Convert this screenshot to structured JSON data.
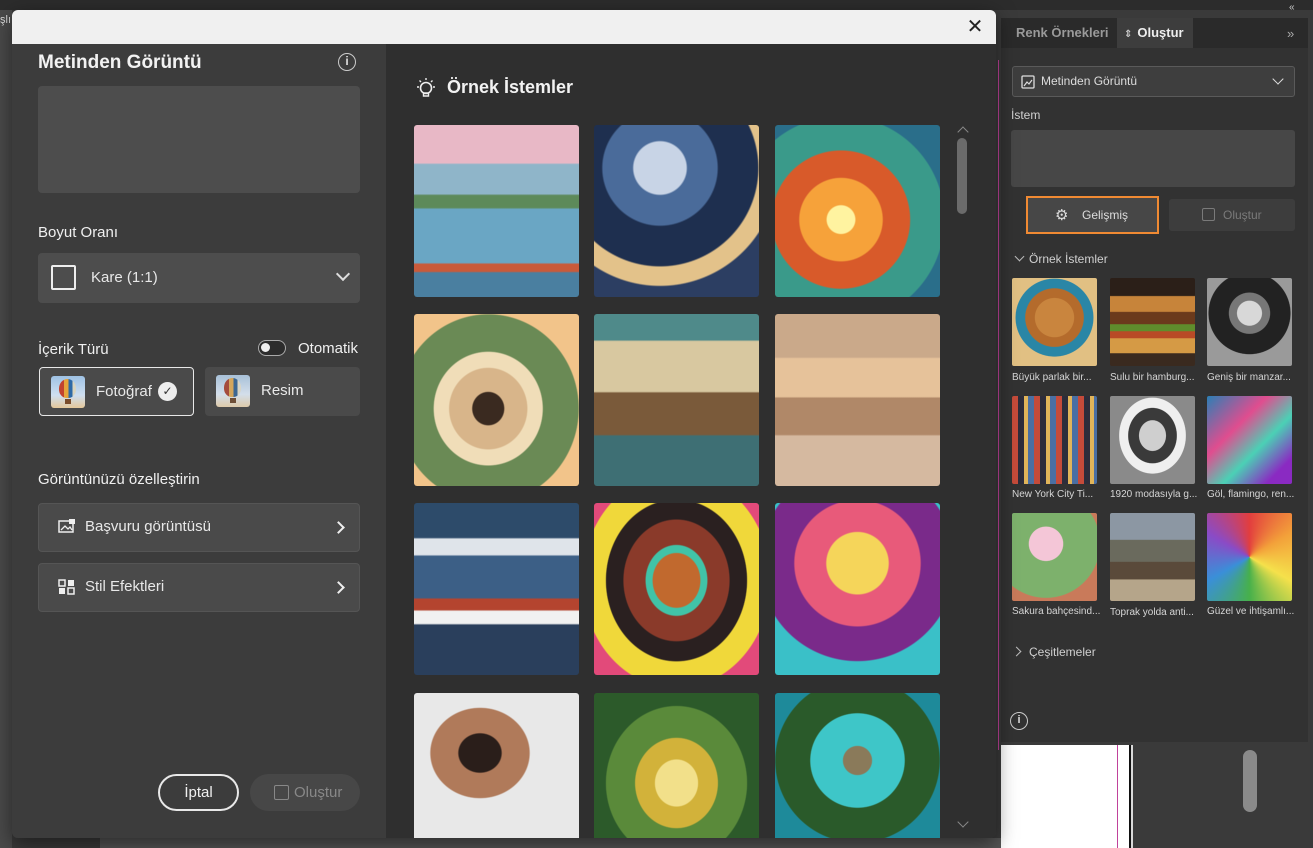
{
  "background": {
    "left_fragment": "şlı"
  },
  "dialog": {
    "close_symbol": "✕",
    "title": "Metinden Görüntü",
    "info_symbol": "i",
    "aspect_label": "Boyut Oranı",
    "aspect_value": "Kare (1:1)",
    "content_type_label": "İçerik Türü",
    "auto_label": "Otomatik",
    "content_types": [
      {
        "label": "Fotoğraf",
        "selected": true
      },
      {
        "label": "Resim",
        "selected": false
      }
    ],
    "customize_label": "Görüntünüzü özelleştirin",
    "reference_label": "Başvuru görüntüsü",
    "styles_label": "Stil Efektleri",
    "cancel_label": "İptal",
    "generate_label": "Oluştur",
    "examples_title": "Örnek İstemler"
  },
  "panel": {
    "tabs": [
      "Renk Örnekleri",
      "Oluştur"
    ],
    "collapse_symbol": "»",
    "top_symbol": "«",
    "mode_value": "Metinden Görüntü",
    "prompt_label": "İstem",
    "advanced_label": "Gelişmiş",
    "generate_label": "Oluştur",
    "examples_label": "Örnek İstemler",
    "variations_label": "Çeşitlemeler",
    "captions": [
      "Büyük parlak bir...",
      "Sulu bir hamburg...",
      "Geniş bir manzar...",
      "New York City Ti...",
      "1920 modasıyla g...",
      "Göl, flamingo, ren...",
      "Sakura bahçesind...",
      "Toprak yolda anti...",
      "Güzel ve ihtişamlı..."
    ],
    "info_symbol": "i"
  },
  "colors": {
    "accent": "#f08a33",
    "dialog_bg": "#3c3c3c",
    "panel_bg": "#323232"
  }
}
